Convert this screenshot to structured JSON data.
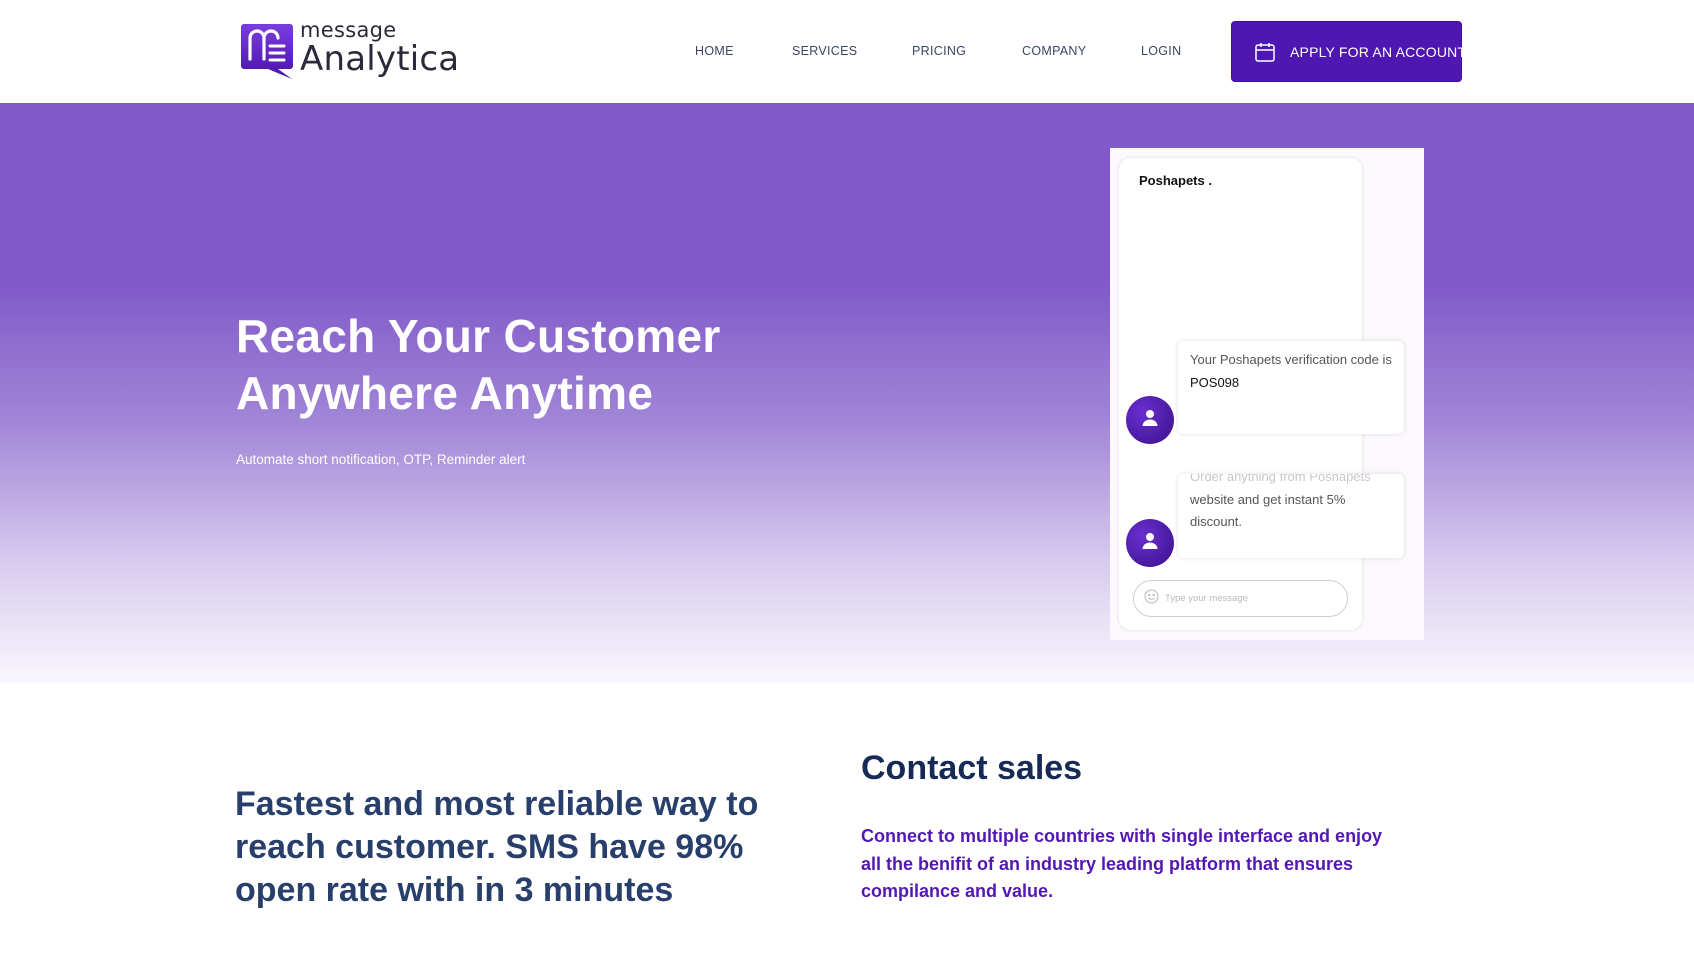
{
  "header": {
    "logo": {
      "small": "message",
      "big": "Analytica",
      "icon": "message-analytica-logo-icon"
    },
    "nav": [
      {
        "label": "HOME"
      },
      {
        "label": "SERVICES"
      },
      {
        "label": "PRICING"
      },
      {
        "label": "COMPANY"
      },
      {
        "label": "LOGIN"
      }
    ],
    "cta": {
      "label": "APPLY FOR AN ACCOUNT",
      "icon": "calendar-icon"
    }
  },
  "hero": {
    "title_line1": "Reach Your Customer",
    "title_line2": "Anywhere Anytime",
    "subtitle": "Automate short notification, OTP, Reminder alert"
  },
  "phone": {
    "brand": "Poshapets .",
    "messages": [
      {
        "text": "Your Poshapets verification code is ",
        "code": "POS098",
        "avatar_icon": "user-icon"
      },
      {
        "faded": "Order anything from Poshapets",
        "text": "website and get instant 5% discount.",
        "avatar_icon": "user-icon"
      }
    ],
    "input_placeholder": "Type your message",
    "input_icon": "smiley-icon"
  },
  "pitch": {
    "text": "Fastest and most reliable way to reach customer. SMS have 98% open rate with in 3 minutes"
  },
  "contact": {
    "title": "Contact sales",
    "text": "Connect to multiple countries with single interface and enjoy all the benifit of an industry leading platform that ensures compilance and value."
  },
  "colors": {
    "brand_purple": "#4f17b1",
    "hero_purple": "#8159c9",
    "navy_text": "#283f6b",
    "contact_text": "#5318b2"
  }
}
